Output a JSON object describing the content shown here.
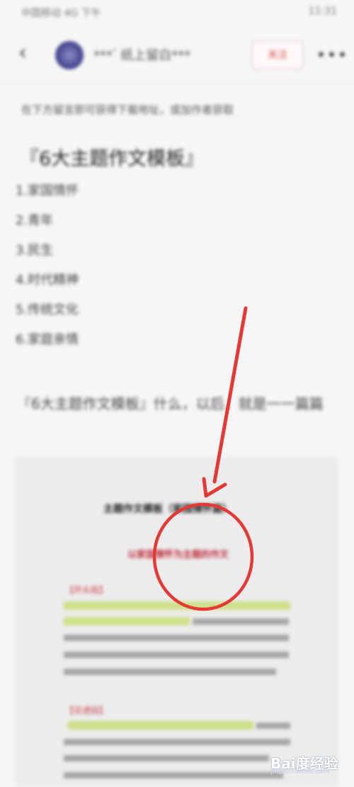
{
  "status_bar": {
    "left_text": "中国移动 4G 下午",
    "right_text": "11:31"
  },
  "nav": {
    "back_icon": "chevron-left-icon",
    "avatar_icon": "avatar-icon",
    "title_prefix": "***",
    "title_sup": "°",
    "title": "纸上留白***",
    "follow_label": "关注",
    "more_icon": "more-dots-icon"
  },
  "article": {
    "subtitle": "在下方留言即可获得下载地址，或加作者获取",
    "heading": "『6大主题作文模板』",
    "list_items": [
      "1.家国情怀",
      "2.青年",
      "3.民生",
      "4.时代精神",
      "5.传统文化",
      "6.家庭亲情"
    ],
    "paragraph": "『6大主题作文模板』什么，以后，就是一一篇篇"
  },
  "doc_preview": {
    "title": "主题作文模板（家国情怀篇）",
    "subtitle": "以家国情怀为主题的作文",
    "label_1": "【开头段】",
    "label_2": "【论述段】"
  },
  "annotation": {
    "color": "#e53935"
  },
  "watermark": {
    "text": "Bai度经验",
    "subtext": "jingyan.baidu.com"
  }
}
